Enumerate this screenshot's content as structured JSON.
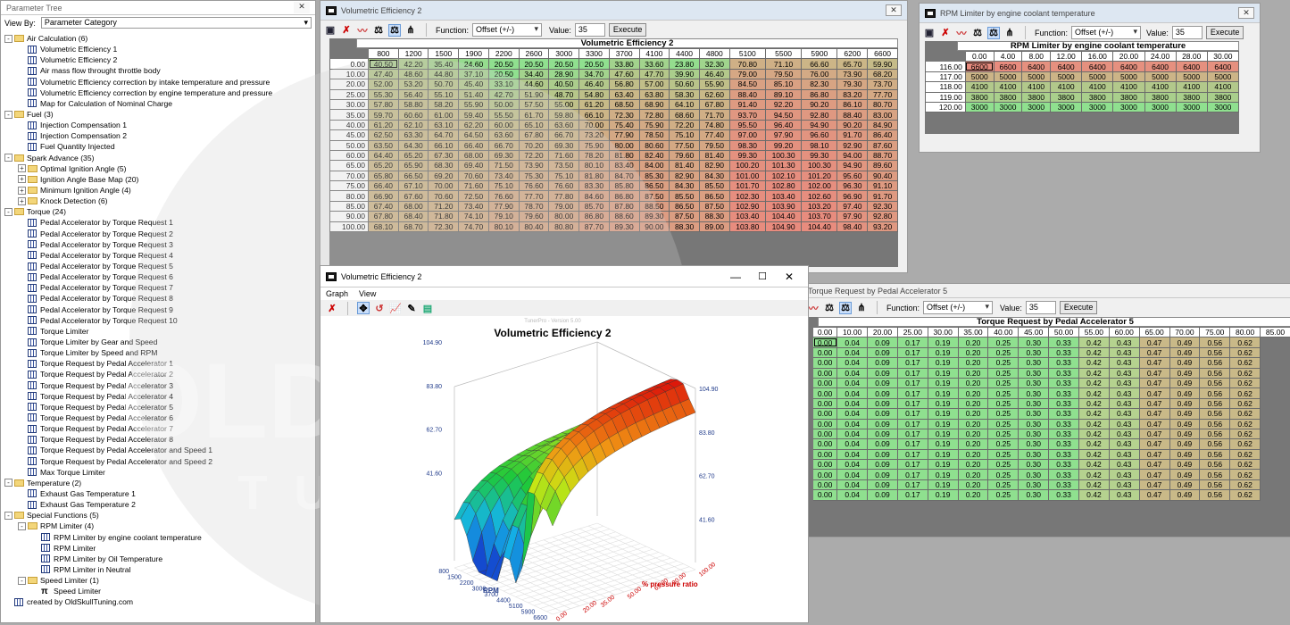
{
  "parameter_tree": {
    "title": "Parameter Tree",
    "view_by_label": "View By:",
    "view_by_value": "Parameter Category",
    "nodes": [
      {
        "level": 0,
        "type": "folder",
        "exp": "-",
        "label": "Air Calculation (6)"
      },
      {
        "level": 1,
        "type": "table",
        "label": "Volumetric Efficiency 1"
      },
      {
        "level": 1,
        "type": "table",
        "label": "Volumetric Efficiency 2"
      },
      {
        "level": 1,
        "type": "table",
        "label": "Air mass flow throught throttle body"
      },
      {
        "level": 1,
        "type": "table",
        "label": "Volumetric Efficiency correction by intake temperature and pressure"
      },
      {
        "level": 1,
        "type": "table",
        "label": "Volumetric Efficiency correction by engine temperature and pressure"
      },
      {
        "level": 1,
        "type": "table",
        "label": "Map for Calculation of Nominal Charge"
      },
      {
        "level": 0,
        "type": "folder",
        "exp": "-",
        "label": "Fuel (3)"
      },
      {
        "level": 1,
        "type": "table",
        "label": "Injection Compensation 1"
      },
      {
        "level": 1,
        "type": "table",
        "label": "Injection Compensation 2"
      },
      {
        "level": 1,
        "type": "table",
        "label": "Fuel Quantity Injected"
      },
      {
        "level": 0,
        "type": "folder",
        "exp": "-",
        "label": "Spark Advance (35)"
      },
      {
        "level": 1,
        "type": "folder",
        "exp": "+",
        "label": "Optimal Ignition Angle (5)"
      },
      {
        "level": 1,
        "type": "folder",
        "exp": "+",
        "label": "Ignition Angle Base Map (20)"
      },
      {
        "level": 1,
        "type": "folder",
        "exp": "+",
        "label": "Minimum Ignition Angle (4)"
      },
      {
        "level": 1,
        "type": "folder",
        "exp": "+",
        "label": "Knock Detection (6)"
      },
      {
        "level": 0,
        "type": "folder",
        "exp": "-",
        "label": "Torque (24)"
      },
      {
        "level": 1,
        "type": "table",
        "label": "Pedal Accelerator by Torque Request 1"
      },
      {
        "level": 1,
        "type": "table",
        "label": "Pedal Accelerator by Torque Request 2"
      },
      {
        "level": 1,
        "type": "table",
        "label": "Pedal Accelerator by Torque Request 3"
      },
      {
        "level": 1,
        "type": "table",
        "label": "Pedal Accelerator by Torque Request 4"
      },
      {
        "level": 1,
        "type": "table",
        "label": "Pedal Accelerator by Torque Request 5"
      },
      {
        "level": 1,
        "type": "table",
        "label": "Pedal Accelerator by Torque Request 6"
      },
      {
        "level": 1,
        "type": "table",
        "label": "Pedal Accelerator by Torque Request 7"
      },
      {
        "level": 1,
        "type": "table",
        "label": "Pedal Accelerator by Torque Request 8"
      },
      {
        "level": 1,
        "type": "table",
        "label": "Pedal Accelerator by Torque Request 9"
      },
      {
        "level": 1,
        "type": "table",
        "label": "Pedal Accelerator by Torque Request 10"
      },
      {
        "level": 1,
        "type": "table",
        "label": "Torque Limiter"
      },
      {
        "level": 1,
        "type": "table",
        "label": "Torque Limiter by Gear and Speed"
      },
      {
        "level": 1,
        "type": "table",
        "label": "Torque Limiter by Speed and RPM"
      },
      {
        "level": 1,
        "type": "table",
        "label": "Torque Request by Pedal Accelerator 1"
      },
      {
        "level": 1,
        "type": "table",
        "label": "Torque Request by Pedal Accelerator 2"
      },
      {
        "level": 1,
        "type": "table",
        "label": "Torque Request by Pedal Accelerator 3"
      },
      {
        "level": 1,
        "type": "table",
        "label": "Torque Request by Pedal Accelerator 4"
      },
      {
        "level": 1,
        "type": "table",
        "label": "Torque Request by Pedal Accelerator 5"
      },
      {
        "level": 1,
        "type": "table",
        "label": "Torque Request by Pedal Accelerator 6"
      },
      {
        "level": 1,
        "type": "table",
        "label": "Torque Request by Pedal Accelerator 7"
      },
      {
        "level": 1,
        "type": "table",
        "label": "Torque Request by Pedal Accelerator 8"
      },
      {
        "level": 1,
        "type": "table",
        "label": "Torque Request by Pedal Accelerator and Speed 1"
      },
      {
        "level": 1,
        "type": "table",
        "label": "Torque Request by Pedal Accelerator and Speed 2"
      },
      {
        "level": 1,
        "type": "table",
        "label": "Max Torque Limiter"
      },
      {
        "level": 0,
        "type": "folder",
        "exp": "-",
        "label": "Temperature (2)"
      },
      {
        "level": 1,
        "type": "table",
        "label": "Exhaust Gas Temperature 1"
      },
      {
        "level": 1,
        "type": "table",
        "label": "Exhaust Gas Temperature 2"
      },
      {
        "level": 0,
        "type": "folder",
        "exp": "-",
        "label": "Special Functions (5)"
      },
      {
        "level": 1,
        "type": "folder",
        "exp": "-",
        "label": "RPM Limiter (4)"
      },
      {
        "level": 2,
        "type": "table",
        "label": "RPM Limiter by engine coolant temperature"
      },
      {
        "level": 2,
        "type": "table",
        "label": "RPM Limiter"
      },
      {
        "level": 2,
        "type": "table",
        "label": "RPM Limiter by Oil Temperature"
      },
      {
        "level": 2,
        "type": "table",
        "label": "RPM Limiter in Neutral"
      },
      {
        "level": 1,
        "type": "folder",
        "exp": "-",
        "label": "Speed Limiter (1)"
      },
      {
        "level": 2,
        "type": "pi",
        "label": "Speed Limiter"
      },
      {
        "level": 0,
        "type": "table",
        "label": "created by OldSkullTuning.com"
      }
    ]
  },
  "ve_window": {
    "title": "Volumetric Efficiency 2",
    "function_label": "Function:",
    "function_value": "Offset (+/-)",
    "value_label": "Value:",
    "value": "35",
    "execute_label": "Execute",
    "table_title": "Volumetric Efficiency 2",
    "columns": [
      "800",
      "1200",
      "1500",
      "1900",
      "2200",
      "2600",
      "3000",
      "3300",
      "3700",
      "4100",
      "4400",
      "4800",
      "5100",
      "5500",
      "5900",
      "6200",
      "6600"
    ],
    "rows": [
      {
        "h": "0.00",
        "v": [
          "40.50",
          "42.20",
          "35.40",
          "24.60",
          "20.50",
          "20.50",
          "20.50",
          "20.50",
          "33.80",
          "33.60",
          "23.80",
          "32.30",
          "70.80",
          "71.10",
          "66.60",
          "65.70",
          "59.90"
        ]
      },
      {
        "h": "10.00",
        "v": [
          "47.40",
          "48.60",
          "44.80",
          "37.10",
          "20.50",
          "34.40",
          "28.90",
          "34.70",
          "47.60",
          "47.70",
          "39.90",
          "46.40",
          "79.00",
          "79.50",
          "76.00",
          "73.90",
          "68.20"
        ]
      },
      {
        "h": "20.00",
        "v": [
          "52.00",
          "53.20",
          "50.70",
          "45.40",
          "33.10",
          "44.60",
          "40.50",
          "46.40",
          "56.80",
          "57.00",
          "50.60",
          "55.90",
          "84.50",
          "85.10",
          "82.30",
          "79.30",
          "73.70"
        ]
      },
      {
        "h": "25.00",
        "v": [
          "55.30",
          "56.40",
          "55.10",
          "51.40",
          "42.70",
          "51.90",
          "48.70",
          "54.80",
          "63.40",
          "63.80",
          "58.30",
          "62.60",
          "88.40",
          "89.10",
          "86.80",
          "83.20",
          "77.70"
        ]
      },
      {
        "h": "30.00",
        "v": [
          "57.80",
          "58.80",
          "58.20",
          "55.90",
          "50.00",
          "57.50",
          "55.00",
          "61.20",
          "68.50",
          "68.90",
          "64.10",
          "67.80",
          "91.40",
          "92.20",
          "90.20",
          "86.10",
          "80.70"
        ]
      },
      {
        "h": "35.00",
        "v": [
          "59.70",
          "60.60",
          "61.00",
          "59.40",
          "55.50",
          "61.70",
          "59.80",
          "66.10",
          "72.30",
          "72.80",
          "68.60",
          "71.70",
          "93.70",
          "94.50",
          "92.80",
          "88.40",
          "83.00"
        ]
      },
      {
        "h": "40.00",
        "v": [
          "61.20",
          "62.10",
          "63.10",
          "62.20",
          "60.00",
          "65.10",
          "63.60",
          "70.00",
          "75.40",
          "75.90",
          "72.20",
          "74.80",
          "95.50",
          "96.40",
          "94.90",
          "90.20",
          "84.90"
        ]
      },
      {
        "h": "45.00",
        "v": [
          "62.50",
          "63.30",
          "64.70",
          "64.50",
          "63.60",
          "67.80",
          "66.70",
          "73.20",
          "77.90",
          "78.50",
          "75.10",
          "77.40",
          "97.00",
          "97.90",
          "96.60",
          "91.70",
          "86.40"
        ]
      },
      {
        "h": "50.00",
        "v": [
          "63.50",
          "64.30",
          "66.10",
          "66.40",
          "66.70",
          "70.20",
          "69.30",
          "75.90",
          "80.00",
          "80.60",
          "77.50",
          "79.50",
          "98.30",
          "99.20",
          "98.10",
          "92.90",
          "87.60"
        ]
      },
      {
        "h": "60.00",
        "v": [
          "64.40",
          "65.20",
          "67.30",
          "68.00",
          "69.30",
          "72.20",
          "71.60",
          "78.20",
          "81.80",
          "82.40",
          "79.60",
          "81.40",
          "99.30",
          "100.30",
          "99.30",
          "94.00",
          "88.70"
        ]
      },
      {
        "h": "65.00",
        "v": [
          "65.20",
          "65.90",
          "68.30",
          "69.40",
          "71.50",
          "73.90",
          "73.50",
          "80.10",
          "83.40",
          "84.00",
          "81.40",
          "82.90",
          "100.20",
          "101.30",
          "100.30",
          "94.90",
          "89.60"
        ]
      },
      {
        "h": "70.00",
        "v": [
          "65.80",
          "66.50",
          "69.20",
          "70.60",
          "73.40",
          "75.30",
          "75.10",
          "81.80",
          "84.70",
          "85.30",
          "82.90",
          "84.30",
          "101.00",
          "102.10",
          "101.20",
          "95.60",
          "90.40"
        ]
      },
      {
        "h": "75.00",
        "v": [
          "66.40",
          "67.10",
          "70.00",
          "71.60",
          "75.10",
          "76.60",
          "76.60",
          "83.30",
          "85.80",
          "86.50",
          "84.30",
          "85.50",
          "101.70",
          "102.80",
          "102.00",
          "96.30",
          "91.10"
        ]
      },
      {
        "h": "80.00",
        "v": [
          "66.90",
          "67.60",
          "70.60",
          "72.50",
          "76.60",
          "77.70",
          "77.80",
          "84.60",
          "86.80",
          "87.50",
          "85.50",
          "86.50",
          "102.30",
          "103.40",
          "102.60",
          "96.90",
          "91.70"
        ]
      },
      {
        "h": "85.00",
        "v": [
          "67.40",
          "68.00",
          "71.20",
          "73.40",
          "77.90",
          "78.70",
          "79.00",
          "85.70",
          "87.80",
          "88.50",
          "86.50",
          "87.50",
          "102.90",
          "103.90",
          "103.20",
          "97.40",
          "92.30"
        ]
      },
      {
        "h": "90.00",
        "v": [
          "67.80",
          "68.40",
          "71.80",
          "74.10",
          "79.10",
          "79.60",
          "80.00",
          "86.80",
          "88.60",
          "89.30",
          "87.50",
          "88.30",
          "103.40",
          "104.40",
          "103.70",
          "97.90",
          "92.80"
        ]
      },
      {
        "h": "100.00",
        "v": [
          "68.10",
          "68.70",
          "72.30",
          "74.70",
          "80.10",
          "80.40",
          "80.80",
          "87.70",
          "89.30",
          "90.00",
          "88.30",
          "89.00",
          "103.80",
          "104.90",
          "104.40",
          "98.40",
          "93.20"
        ]
      }
    ]
  },
  "rpm_window": {
    "title": "RPM Limiter by engine coolant temperature",
    "function_label": "Function:",
    "function_value": "Offset (+/-)",
    "value_label": "Value:",
    "value": "35",
    "execute_label": "Execute",
    "table_title": "RPM Limiter by engine coolant temperature",
    "columns": [
      "0.00",
      "4.00",
      "8.00",
      "12.00",
      "16.00",
      "20.00",
      "24.00",
      "28.00",
      "30.00"
    ],
    "rows": [
      {
        "h": "116.00",
        "v": [
          "6600",
          "6600",
          "6400",
          "6400",
          "6400",
          "6400",
          "6400",
          "6400",
          "6400"
        ]
      },
      {
        "h": "117.00",
        "v": [
          "5000",
          "5000",
          "5000",
          "5000",
          "5000",
          "5000",
          "5000",
          "5000",
          "5000"
        ]
      },
      {
        "h": "118.00",
        "v": [
          "4100",
          "4100",
          "4100",
          "4100",
          "4100",
          "4100",
          "4100",
          "4100",
          "4100"
        ]
      },
      {
        "h": "119.00",
        "v": [
          "3800",
          "3800",
          "3800",
          "3800",
          "3800",
          "3800",
          "3800",
          "3800",
          "3800"
        ]
      },
      {
        "h": "120.00",
        "v": [
          "3000",
          "3000",
          "3000",
          "3000",
          "3000",
          "3000",
          "3000",
          "3000",
          "3000"
        ]
      }
    ]
  },
  "torque_window": {
    "title": "Torque Request by Pedal Accelerator 5",
    "function_label": "Function:",
    "function_value": "Offset (+/-)",
    "value_label": "Value:",
    "value": "35",
    "execute_label": "Execute",
    "table_title": "Torque Request by Pedal Accelerator 5",
    "columns": [
      "0.00",
      "10.00",
      "20.00",
      "25.00",
      "30.00",
      "35.00",
      "40.00",
      "45.00",
      "50.00",
      "55.00",
      "60.00",
      "65.00",
      "70.00",
      "75.00",
      "80.00",
      "85.00"
    ],
    "row_values": [
      "0.00",
      "0.04",
      "0.09",
      "0.17",
      "0.19",
      "0.20",
      "0.25",
      "0.30",
      "0.33",
      "0.42",
      "0.43",
      "0.47",
      "0.49",
      "0.56",
      "0.62"
    ],
    "row_count": 16
  },
  "graph_window": {
    "title": "Volumetric Efficiency 2",
    "menu": [
      "Graph",
      "View"
    ],
    "watermark": "TunerPro - Version 5.00",
    "chart_title": "Volumetric Efficiency 2",
    "z_ticks": [
      "104.90",
      "83.80",
      "62.70",
      "41.60"
    ],
    "x_axis_label": "RPM",
    "x_ticks": [
      "800",
      "1500",
      "2200",
      "3000",
      "3700",
      "4400",
      "5100",
      "5900",
      "6600"
    ],
    "y_axis_label": "% pressure ratio",
    "y_ticks": [
      "0.00",
      "20.00",
      "35.00",
      "50.00",
      "65.00",
      "80.00",
      "100.00"
    ]
  },
  "watermark_text": {
    "line1": "OLDSKULL",
    "line2": "TUNING"
  },
  "colors": {
    "accent_blue": "#1f4fa8",
    "cell_red": "#e88b7e",
    "cell_green": "#8fe08f",
    "cell_tan": "#c9b988"
  }
}
